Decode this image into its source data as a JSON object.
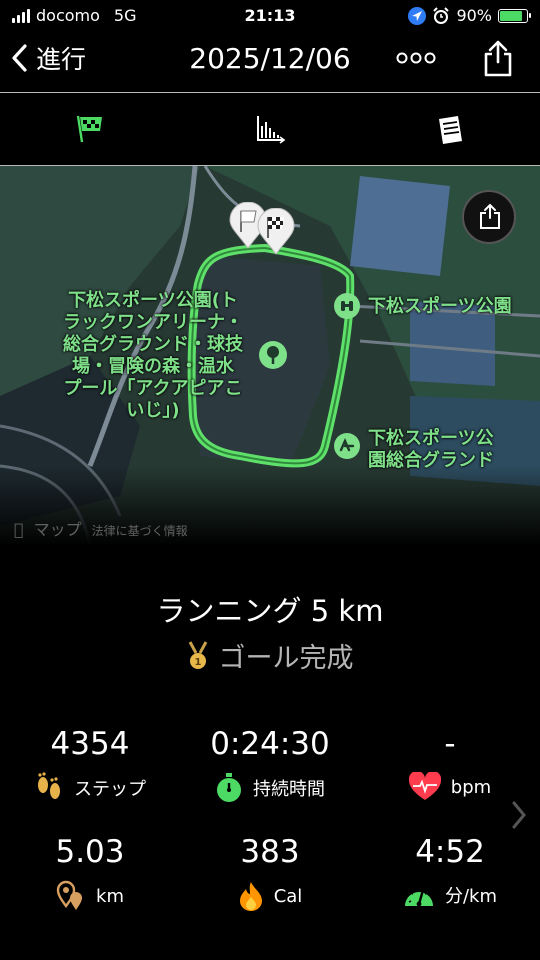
{
  "status_bar": {
    "carrier": "docomo",
    "network": "5G",
    "time": "21:13",
    "battery": "90%"
  },
  "nav": {
    "back_label": "進行",
    "title": "2025/12/06",
    "more": "○○○"
  },
  "tabs": [
    {
      "name": "flag-tab"
    },
    {
      "name": "chart-tab"
    },
    {
      "name": "list-tab"
    }
  ],
  "map": {
    "park_label": "下松スポーツ公園(トラックワンアリーナ・総合グラウンド・球技場・冒険の森・温水プール「アクアピアこいじ」)",
    "park_label_lines": [
      "下松スポーツ公園(ト",
      "ラックワンアリーナ・",
      "総合グラウンド・球技",
      "場・冒険の森・温水",
      "プール「アクアピアこ",
      "いじ」)"
    ],
    "park_right": "下松スポーツ公園",
    "ground_lines": [
      "下松スポーツ公",
      "園総合グランド"
    ],
    "attribution": "マップ",
    "attribution_sub": "法律に基づく情報"
  },
  "workout": {
    "name": "ランニング 5 km",
    "goal": "ゴール完成"
  },
  "stats": [
    {
      "value": "4354",
      "unit": "ステップ",
      "icon": "footprints-icon",
      "color": "#e8b24a"
    },
    {
      "value": "0:24:30",
      "unit": "持続時間",
      "icon": "stopwatch-icon",
      "color": "#4cd964"
    },
    {
      "value": "-",
      "unit": "bpm",
      "icon": "heart-icon",
      "color": "#ff3b4e"
    },
    {
      "value": "5.03",
      "unit": "km",
      "icon": "location-pin-icon",
      "color": "#d8a060"
    },
    {
      "value": "383",
      "unit": "Cal",
      "icon": "flame-icon",
      "color": "#ff9500"
    },
    {
      "value": "4:52",
      "unit": "分/km",
      "icon": "speedometer-icon",
      "color": "#4cd964"
    }
  ],
  "colors": {
    "accent": "#4cd964",
    "route": "#5fe06a",
    "map_bg": "#2b3b37"
  }
}
